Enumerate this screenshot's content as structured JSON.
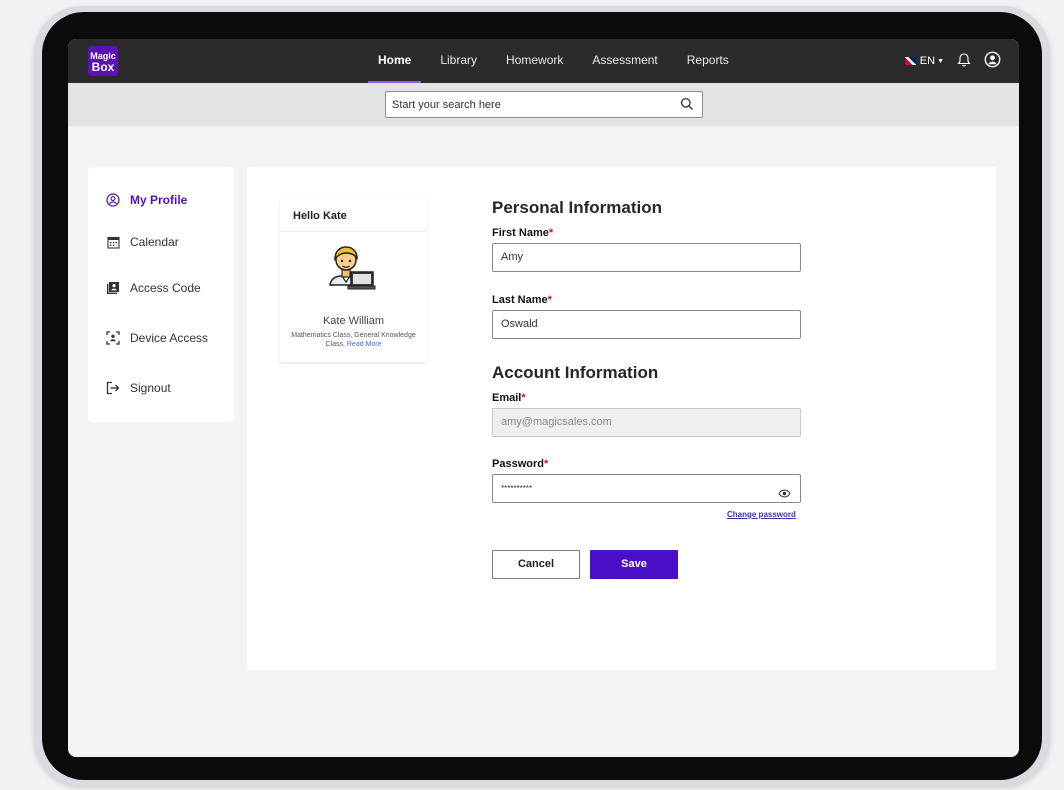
{
  "app": {
    "logo_line1": "Magic",
    "logo_line2": "Box"
  },
  "nav": {
    "items": [
      {
        "label": "Home",
        "active": true
      },
      {
        "label": "Library"
      },
      {
        "label": "Homework"
      },
      {
        "label": "Assessment"
      },
      {
        "label": "Reports"
      }
    ],
    "language": "EN"
  },
  "search": {
    "placeholder": "Start your search here"
  },
  "sidebar": {
    "items": [
      {
        "label": "My Profile",
        "icon": "user-circle-icon",
        "active": true
      },
      {
        "label": "Calendar",
        "icon": "calendar-icon"
      },
      {
        "label": "Access Code",
        "icon": "access-code-icon"
      },
      {
        "label": "Device Access",
        "icon": "device-access-icon"
      },
      {
        "label": "Signout",
        "icon": "signout-icon"
      }
    ]
  },
  "profile_card": {
    "greeting": "Hello Kate",
    "name": "Kate William",
    "classes": "Mathematics Class, General Knowledge Class,",
    "read_more": "Read More"
  },
  "personal_info": {
    "title": "Personal Information",
    "first_name_label": "First Name",
    "first_name_value": "Amy",
    "last_name_label": "Last Name",
    "last_name_value": "Oswald"
  },
  "account_info": {
    "title": "Account Information",
    "email_label": "Email",
    "email_value": "amy@magicsales.com",
    "password_label": "Password",
    "password_value": "**********",
    "change_password": "Change password"
  },
  "actions": {
    "cancel": "Cancel",
    "save": "Save"
  },
  "colors": {
    "brand": "#4a0fc7",
    "topbar": "#2b2b2d",
    "required": "#c4161c"
  }
}
